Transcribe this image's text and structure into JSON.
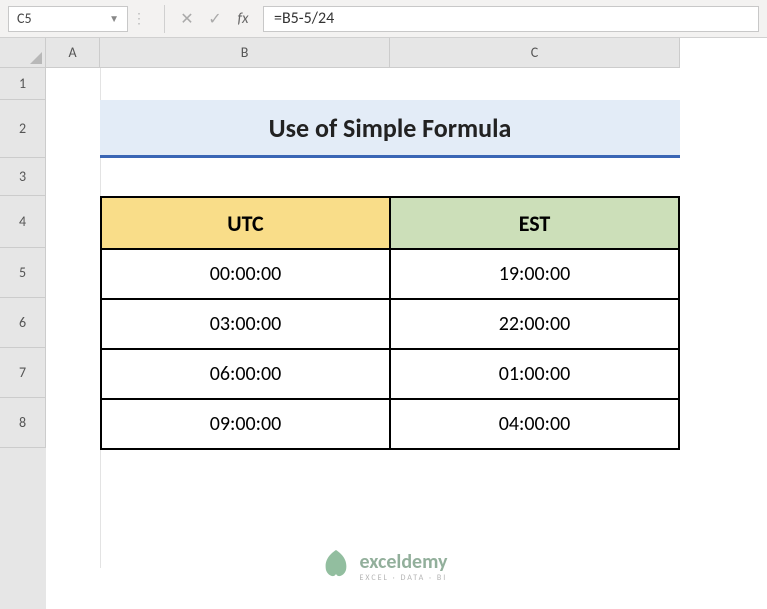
{
  "name_box": "C5",
  "formula": "=B5-5/24",
  "fx_label": "fx",
  "col_headers": [
    "A",
    "B",
    "C"
  ],
  "row_headers": [
    "1",
    "2",
    "3",
    "4",
    "5",
    "6",
    "7",
    "8"
  ],
  "title": "Use of Simple Formula",
  "table": {
    "headers": {
      "utc": "UTC",
      "est": "EST"
    },
    "rows": [
      {
        "utc": "00:00:00",
        "est": "19:00:00"
      },
      {
        "utc": "03:00:00",
        "est": "22:00:00"
      },
      {
        "utc": "06:00:00",
        "est": "01:00:00"
      },
      {
        "utc": "09:00:00",
        "est": "04:00:00"
      }
    ]
  },
  "watermark": {
    "name": "exceldemy",
    "tagline": "EXCEL · DATA · BI"
  }
}
